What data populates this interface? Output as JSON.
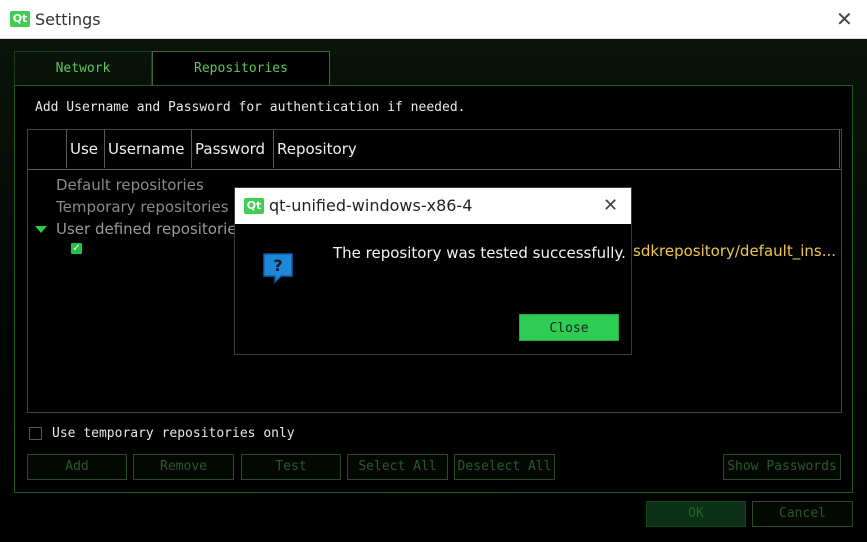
{
  "window": {
    "title": "Settings",
    "logo_text": "Qt",
    "close_glyph": "✕"
  },
  "tabs": [
    {
      "label": "Network",
      "active": false
    },
    {
      "label": "Repositories",
      "active": true
    }
  ],
  "panel": {
    "hint": "Add Username and Password for authentication if needed.",
    "columns": [
      "Use",
      "Username",
      "Password",
      "Repository"
    ],
    "rows": {
      "default": "Default repositories",
      "temporary": "Temporary repositories",
      "user_defined": "User defined repositorie",
      "repo_url": "sdkrepository/default_ins..."
    },
    "checkbox_label": "Use temporary repositories only",
    "buttons": {
      "add": "Add",
      "remove": "Remove",
      "test": "Test",
      "select_all": "Select All",
      "deselect_all": "Deselect All",
      "show_passwords": "Show Passwords"
    }
  },
  "footer": {
    "ok": "OK",
    "cancel": "Cancel"
  },
  "dialog": {
    "title": "qt-unified-windows-x86-4",
    "logo_text": "Qt",
    "close_glyph": "✕",
    "message": "The repository was tested successfully.",
    "close_button": "Close",
    "icon": "question-icon"
  },
  "colors": {
    "accent_green": "#2ecc55",
    "url_yellow": "#f2c64a",
    "tab_text": "#5cc85c"
  }
}
